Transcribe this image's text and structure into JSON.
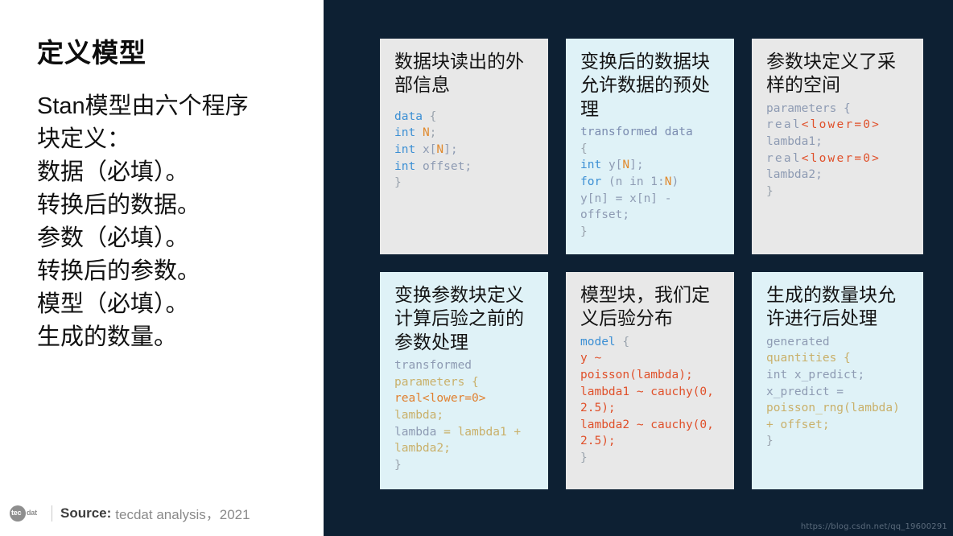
{
  "colors": {
    "right_background": "#0d2033",
    "left_background": "#ffffff",
    "card_gray": "#e8e8e8",
    "card_cyan": "#dff2f7",
    "keyword_blue": "#3b8fd4",
    "identifier_gray": "#8e9bb3",
    "accent_orange": "#e08a2e",
    "accent_red": "#e0502a",
    "accent_tan": "#c9b06a"
  },
  "left": {
    "title": "定义模型",
    "lines": [
      "Stan模型由六个程序",
      "块定义：",
      "数据（必填）。",
      "转换后的数据。",
      "参数（必填）。",
      "转换后的参数。",
      "模型（必填）。",
      "生成的数量。"
    ],
    "source": {
      "logo_primary": "tec",
      "logo_secondary": "dat",
      "label": "Source:",
      "text": "tecdat analysis，2021"
    }
  },
  "watermark": "https://blog.csdn.net/qq_19600291",
  "cards": [
    {
      "id": "data-block",
      "theme": "gray",
      "title": "数据块读出的外部信息",
      "code_lines": [
        [
          {
            "t": "data",
            "c": "c-key"
          },
          {
            "t": " {",
            "c": "c-punct"
          }
        ],
        [
          {
            "t": "int",
            "c": "c-key"
          },
          {
            "t": " ",
            "c": "c-punct"
          },
          {
            "t": "N",
            "c": "c-num"
          },
          {
            "t": ";",
            "c": "c-punct"
          }
        ],
        [
          {
            "t": "int",
            "c": "c-key"
          },
          {
            "t": " ",
            "c": "c-punct"
          },
          {
            "t": "x",
            "c": "c-var"
          },
          {
            "t": "[",
            "c": "c-var"
          },
          {
            "t": "N",
            "c": "c-num"
          },
          {
            "t": "];",
            "c": "c-var"
          }
        ],
        [
          {
            "t": "int",
            "c": "c-key"
          },
          {
            "t": " ",
            "c": "c-punct"
          },
          {
            "t": "offset",
            "c": "c-var"
          },
          {
            "t": ";",
            "c": "c-var"
          }
        ],
        [
          {
            "t": "}",
            "c": "c-punct"
          }
        ]
      ]
    },
    {
      "id": "transformed-data-block",
      "theme": "cyan",
      "title": "变换后的数据块允许数据的预处理",
      "code_lines": [
        [
          {
            "t": "transformed data",
            "c": "c-kw2"
          }
        ],
        [
          {
            "t": "{",
            "c": "c-punct"
          }
        ],
        [
          {
            "t": "int",
            "c": "c-key"
          },
          {
            "t": " ",
            "c": "c-punct"
          },
          {
            "t": "y",
            "c": "c-var"
          },
          {
            "t": "[",
            "c": "c-var"
          },
          {
            "t": "N",
            "c": "c-num"
          },
          {
            "t": "];",
            "c": "c-var"
          }
        ],
        [
          {
            "t": "for",
            "c": "c-key"
          },
          {
            "t": " (n in 1:",
            "c": "c-var"
          },
          {
            "t": "N",
            "c": "c-num"
          },
          {
            "t": ")",
            "c": "c-var"
          }
        ],
        [
          {
            "t": "y[n] = x[n] -",
            "c": "c-var"
          }
        ],
        [
          {
            "t": "offset;",
            "c": "c-var"
          }
        ],
        [
          {
            "t": "}",
            "c": "c-punct"
          }
        ]
      ]
    },
    {
      "id": "parameters-block",
      "theme": "gray",
      "title": "参数块定义了采样的空间",
      "code_lines": [
        [
          {
            "t": "parameters {",
            "c": "c-var"
          }
        ],
        [
          {
            "t": "real",
            "c": "c-var sp"
          },
          {
            "t": "<lower=0>",
            "c": "c-red sp"
          }
        ],
        [
          {
            "t": "lambda1;",
            "c": "c-var"
          }
        ],
        [
          {
            "t": "real",
            "c": "c-var sp"
          },
          {
            "t": "<lower=0>",
            "c": "c-red sp"
          }
        ],
        [
          {
            "t": "lambda2;",
            "c": "c-var"
          }
        ],
        [
          {
            "t": "}",
            "c": "c-punct"
          }
        ]
      ]
    },
    {
      "id": "transformed-parameters-block",
      "theme": "cyan",
      "title": "变换参数块定义计算后验之前的参数处理",
      "code_lines": [
        [
          {
            "t": "transformed",
            "c": "c-var"
          }
        ],
        [
          {
            "t": "parameters {",
            "c": "c-tan"
          }
        ],
        [
          {
            "t": "real<lower=0>",
            "c": "c-orange2"
          }
        ],
        [
          {
            "t": "lambda;",
            "c": "c-tan"
          }
        ],
        [
          {
            "t": "lambda",
            "c": "c-var"
          },
          {
            "t": " = lambda1 +",
            "c": "c-tan"
          }
        ],
        [
          {
            "t": "lambda2;",
            "c": "c-tan"
          }
        ],
        [
          {
            "t": "}",
            "c": "c-punct"
          }
        ]
      ]
    },
    {
      "id": "model-block",
      "theme": "gray",
      "title": "模型块，我们定义后验分布",
      "code_lines": [
        [
          {
            "t": "model",
            "c": "c-key"
          },
          {
            "t": " {",
            "c": "c-punct"
          }
        ],
        [
          {
            "t": "y ~",
            "c": "c-red"
          }
        ],
        [
          {
            "t": "poisson(lambda);",
            "c": "c-red"
          }
        ],
        [
          {
            "t": "lambda1 ~ cauchy(0,",
            "c": "c-red"
          }
        ],
        [
          {
            "t": "2.5);",
            "c": "c-red"
          }
        ],
        [
          {
            "t": "lambda2 ~ cauchy(0,",
            "c": "c-red"
          }
        ],
        [
          {
            "t": "2.5);",
            "c": "c-red"
          }
        ],
        [
          {
            "t": "}",
            "c": "c-punct"
          }
        ]
      ]
    },
    {
      "id": "generated-quantities-block",
      "theme": "cyan",
      "title": "生成的数量块允许进行后处理",
      "code_lines": [
        [
          {
            "t": "generated",
            "c": "c-var"
          }
        ],
        [
          {
            "t": "quantities {",
            "c": "c-tan"
          }
        ],
        [
          {
            "t": "int x_predict;",
            "c": "c-var"
          }
        ],
        [
          {
            "t": "x_predict =",
            "c": "c-var"
          }
        ],
        [
          {
            "t": "poisson_rng(lambda)",
            "c": "c-tan"
          }
        ],
        [
          {
            "t": "+ offset;",
            "c": "c-tan"
          }
        ],
        [
          {
            "t": "}",
            "c": "c-punct"
          }
        ]
      ]
    }
  ]
}
